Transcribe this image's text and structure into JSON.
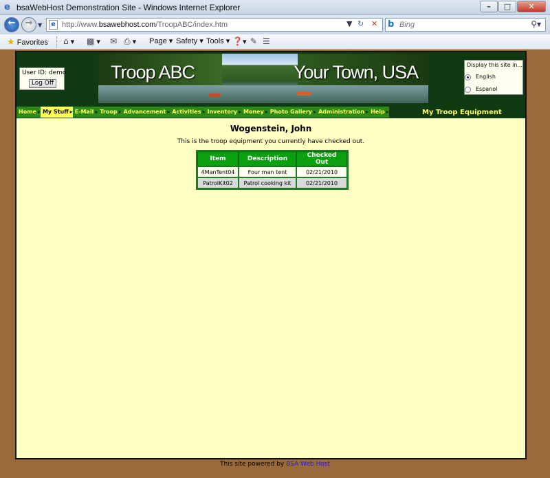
{
  "window": {
    "title": "bsaWebHost Demonstration Site - Windows Internet Explorer",
    "buttons": {
      "minimize": "–",
      "maximize": "□",
      "close": "✕"
    }
  },
  "address_bar": {
    "url_prefix": "http://www.",
    "url_domain": "bsawebhost.com",
    "url_path": "/TroopABC/index.htm",
    "search_placeholder": "Bing"
  },
  "favorites_bar": {
    "favorites_label": "Favorites",
    "page_label": "Page",
    "safety_label": "Safety",
    "tools_label": "Tools"
  },
  "site": {
    "login": {
      "user_id_label": "User ID:",
      "user_id": "demo",
      "log_off": "Log Off"
    },
    "banner": {
      "left_text": "Troop ABC",
      "right_text": "Your Town, USA"
    },
    "language": {
      "title": "Display this site in...",
      "options": [
        {
          "label": "English",
          "selected": true
        },
        {
          "label": "Espanol",
          "selected": false
        }
      ]
    },
    "menu": {
      "items": [
        "Home",
        "My Stuff",
        "E-Mail",
        "Troop",
        "Advancement",
        "Activities",
        "Inventory",
        "Money",
        "Photo Gallery",
        "Administration",
        "Help"
      ],
      "active": "My Stuff",
      "section_title": "My Troop Equipment"
    },
    "content": {
      "name": "Wogenstein, John",
      "description": "This is the troop equipment you currently have checked out.",
      "table": {
        "headers": [
          "Item",
          "Description",
          "Checked Out"
        ],
        "rows": [
          [
            "4ManTent04",
            "Four man tent",
            "02/21/2010"
          ],
          [
            "PatrolKit02",
            "Patrol cooking kit",
            "02/21/2010"
          ]
        ]
      }
    },
    "footer": {
      "text": "This site powered by",
      "link": "BSA Web Host"
    }
  },
  "colors": {
    "page_background": "#9a6a3a",
    "site_background": "#ffffc4",
    "header_green": "#0f3a12",
    "menu_green": "#2c8a18",
    "menu_text": "#ffff66",
    "table_header": "#0aa010"
  }
}
